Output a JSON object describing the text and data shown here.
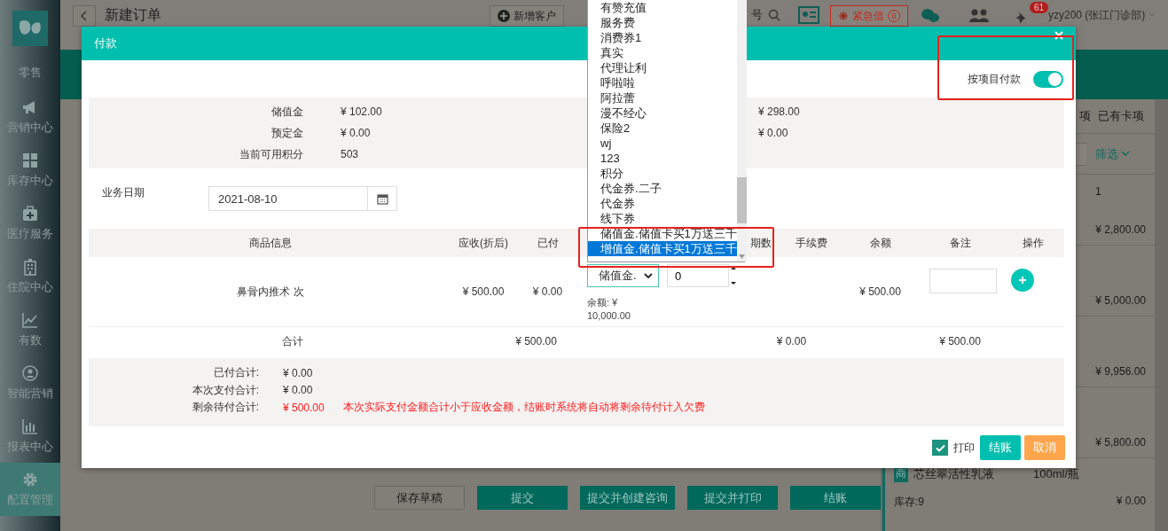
{
  "sidebar": {
    "items": [
      {
        "label": "零售",
        "selected": false
      },
      {
        "label": "营销中心",
        "selected": false
      },
      {
        "label": "库存中心",
        "selected": false
      },
      {
        "label": "医疗服务",
        "selected": false
      },
      {
        "label": "住院中心",
        "selected": false
      },
      {
        "label": "有数",
        "selected": false
      },
      {
        "label": "智能营销",
        "selected": false
      },
      {
        "label": "报表中心",
        "selected": false
      },
      {
        "label": "配置管理",
        "selected": true
      }
    ]
  },
  "top_bar": {
    "title": "新建订单",
    "new_customer_button": "新增客户",
    "search_text": "号",
    "emergency_button": "紧急值",
    "emergency_count": "0",
    "notification_count": "61",
    "user": "yzy200 (张江门诊部)"
  },
  "right_panel": {
    "tabs": [
      "项",
      "已有卡项"
    ],
    "filter_button": "筛选",
    "rows": [
      {
        "quantity": "1",
        "amount": "¥ 2,800.00"
      },
      {
        "amount": "¥ 5,000.00"
      },
      {
        "amount": "¥ 9,956.00"
      },
      {
        "amount": "¥ 5,800.00"
      }
    ],
    "product": {
      "tag": "商",
      "name": "芯丝翠活性乳液",
      "spec": "100ml/瓶",
      "stock": "库存:9",
      "amount": "¥ 0.00"
    }
  },
  "actions": [
    {
      "label": "保存草稿",
      "kind": "secondary"
    },
    {
      "label": "提交",
      "kind": "primary"
    },
    {
      "label": "提交并创建咨询",
      "kind": "primary"
    },
    {
      "label": "提交并打印",
      "kind": "primary"
    },
    {
      "label": "结账",
      "kind": "primary"
    }
  ],
  "payment_dialog": {
    "title": "付款",
    "pay_by_item": {
      "label": "按项目付款",
      "on": true
    },
    "balances": [
      {
        "label": "储值金",
        "value": "¥ 102.00",
        "value_2": "¥ 298.00"
      },
      {
        "label": "预定金",
        "value": "¥ 0.00",
        "value_2": "¥ 0.00"
      },
      {
        "label": "当前可用积分",
        "value": "503"
      }
    ],
    "business_date": {
      "label": "业务日期",
      "value": "2021-08-10"
    },
    "table": {
      "columns": [
        "商品信息",
        "应收(折后)",
        "已付",
        "期数",
        "手续费",
        "余额",
        "备注",
        "操作"
      ],
      "rows": [
        {
          "product": "鼻骨内推术 次",
          "receivable": "¥ 500.00",
          "paid": "¥ 0.00",
          "method": "储值金.",
          "amount": "0",
          "method_balance": "余额: ¥ 10,000.00",
          "balance": "¥ 500.00"
        }
      ],
      "total": {
        "label": "合计",
        "receivable": "¥ 500.00",
        "fee": "¥ 0.00",
        "balance": "¥ 500.00"
      }
    },
    "summary": [
      {
        "label": "已付合计:",
        "value": "¥ 0.00",
        "alert": false
      },
      {
        "label": "本次支付合计:",
        "value": "¥ 0.00",
        "alert": false
      },
      {
        "label": "剩余待付合计:",
        "value": "¥ 500.00",
        "alert": true,
        "warning": "本次实际支付金额合计小于应收金额，结账时系统将自动将剩余待付计入欠费"
      }
    ],
    "print": {
      "label": "打印",
      "checked": true
    },
    "checkout_button": "结账",
    "cancel_button": "取消"
  },
  "payment_options": {
    "options": [
      {
        "label": "有赞充值",
        "selected": false
      },
      {
        "label": "服务费",
        "selected": false
      },
      {
        "label": "消费券1",
        "selected": false
      },
      {
        "label": "真实",
        "selected": false
      },
      {
        "label": "代理让利",
        "selected": false
      },
      {
        "label": "呼啦啦",
        "selected": false
      },
      {
        "label": "阿拉蕾",
        "selected": false
      },
      {
        "label": "漫不经心",
        "selected": false
      },
      {
        "label": "保险2",
        "selected": false
      },
      {
        "label": "wj",
        "selected": false
      },
      {
        "label": "123",
        "selected": false
      },
      {
        "label": "积分",
        "selected": false
      },
      {
        "label": "代金券.二子",
        "selected": false
      },
      {
        "label": "代金券",
        "selected": false
      },
      {
        "label": "线下券",
        "selected": false
      },
      {
        "label": "储值金.储值卡买1万送三千",
        "selected": false
      },
      {
        "label": "增值金.储值卡买1万送三千",
        "selected": true
      }
    ]
  }
}
